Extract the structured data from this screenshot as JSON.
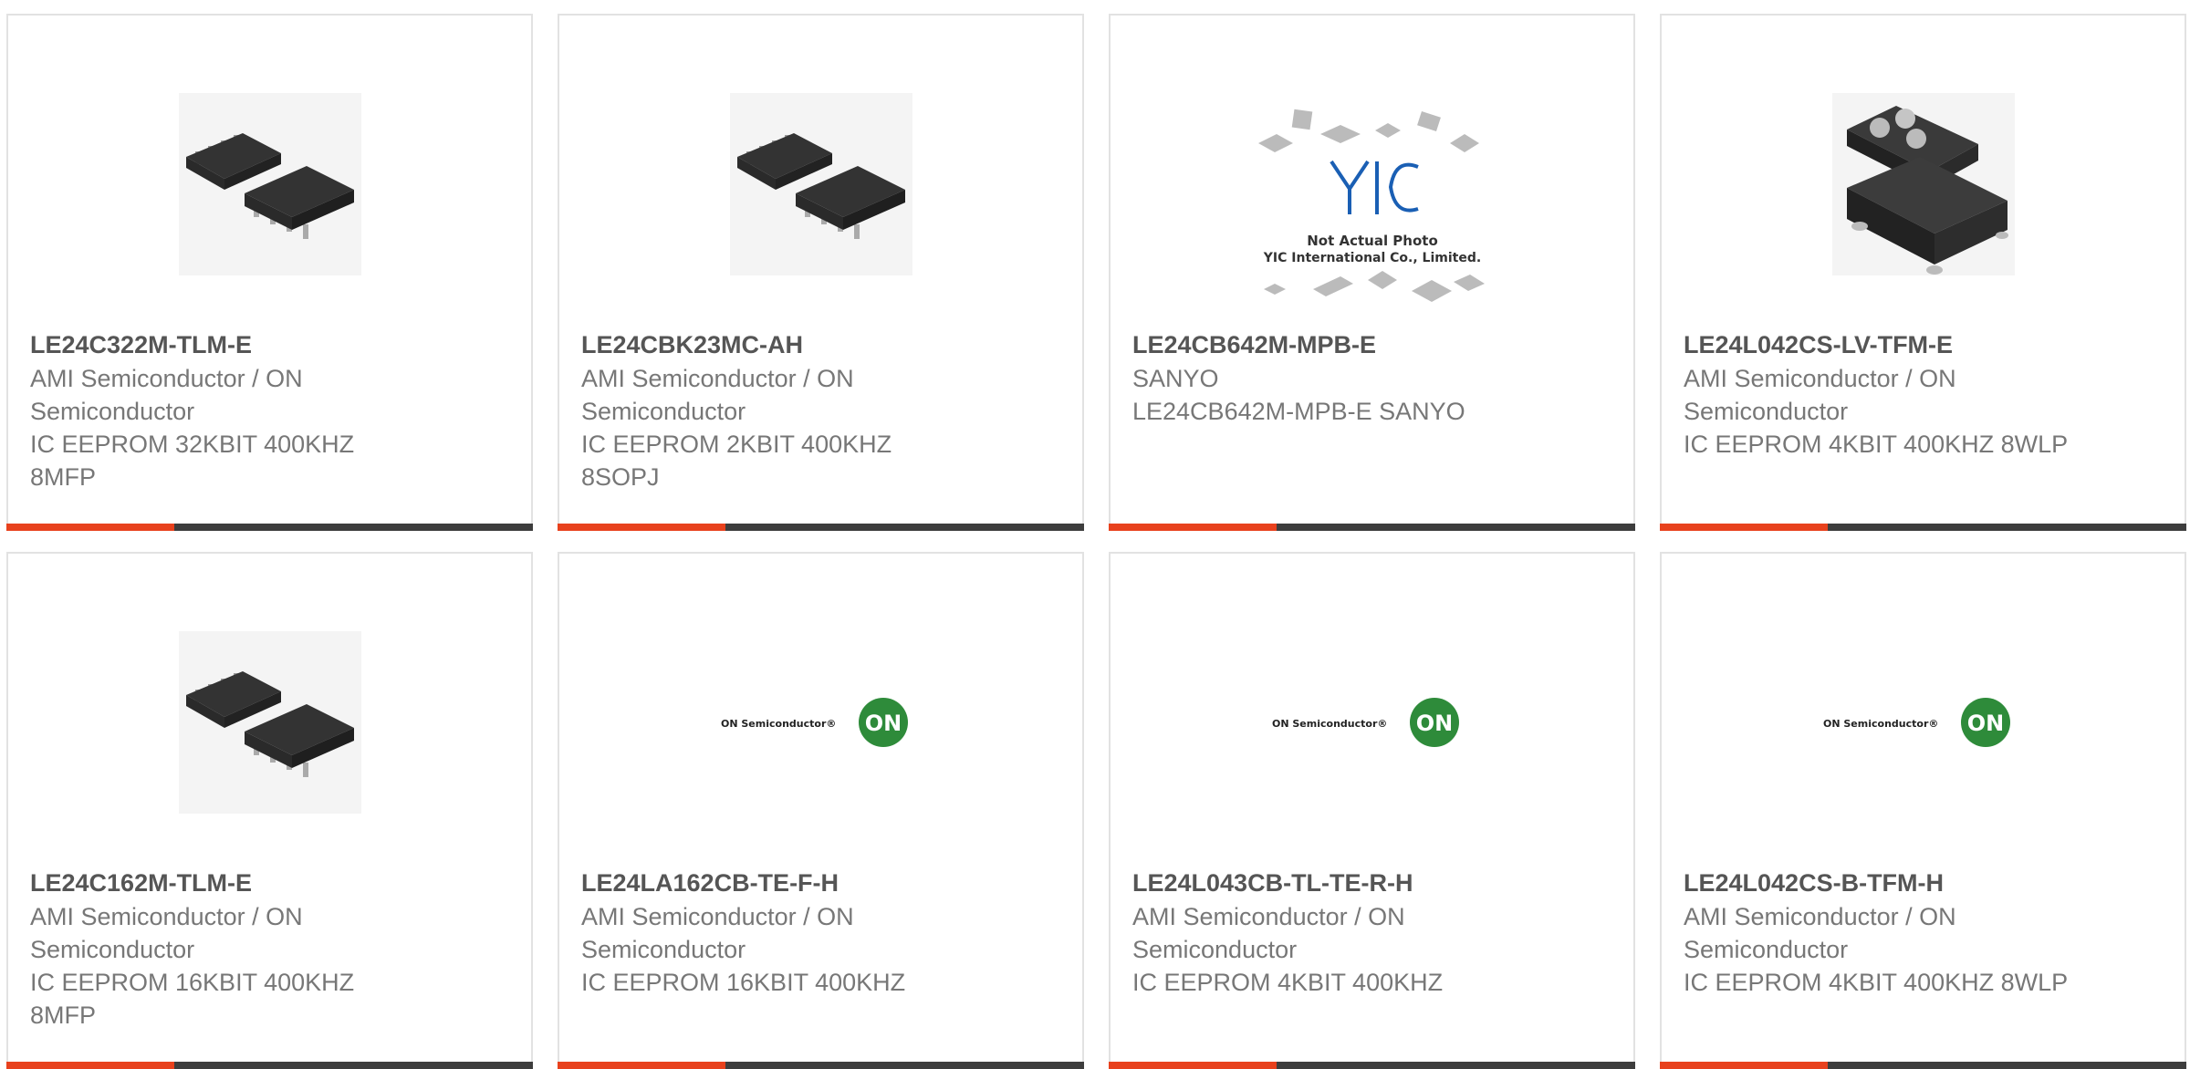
{
  "cards": [
    {
      "part": "LE24C322M-TLM-E",
      "maker": "AMI Semiconductor / ON Semiconductor",
      "desc": "IC EEPROM 32KBIT 400KHZ 8MFP",
      "image": "soic8-chip-icon"
    },
    {
      "part": "LE24CBK23MC-AH",
      "maker": "AMI Semiconductor / ON Semiconductor",
      "desc": "IC EEPROM 2KBIT 400KHZ 8SOPJ",
      "image": "soic8-chip-icon"
    },
    {
      "part": "LE24CB642M-MPB-E",
      "maker": "SANYO",
      "desc": "LE24CB642M-MPB-E SANYO",
      "image": "yic-not-actual-photo-icon",
      "placeholder_lines": [
        "Not Actual Photo",
        "YIC International Co., Limited."
      ],
      "placeholder_logo": "YIC"
    },
    {
      "part": "LE24L042CS-LV-TFM-E",
      "maker": "AMI Semiconductor / ON Semiconductor",
      "desc": "IC EEPROM 4KBIT 400KHZ 8WLP",
      "image": "wlp-chip-icon"
    },
    {
      "part": "LE24C162M-TLM-E",
      "maker": "AMI Semiconductor / ON Semiconductor",
      "desc": "IC EEPROM 16KBIT 400KHZ 8MFP",
      "image": "soic8-chip-icon"
    },
    {
      "part": "LE24LA162CB-TE-F-H",
      "maker": "AMI Semiconductor / ON Semiconductor",
      "desc": "IC EEPROM 16KBIT 400KHZ",
      "image": "on-semiconductor-logo",
      "logo_text": "ON Semiconductor®",
      "logo_badge": "ON"
    },
    {
      "part": "LE24L043CB-TL-TE-R-H",
      "maker": "AMI Semiconductor / ON Semiconductor",
      "desc": "IC EEPROM 4KBIT 400KHZ",
      "image": "on-semiconductor-logo",
      "logo_text": "ON Semiconductor®",
      "logo_badge": "ON"
    },
    {
      "part": "LE24L042CS-B-TFM-H",
      "maker": "AMI Semiconductor / ON Semiconductor",
      "desc": "IC EEPROM 4KBIT 400KHZ 8WLP",
      "image": "on-semiconductor-logo",
      "logo_text": "ON Semiconductor®",
      "logo_badge": "ON"
    }
  ],
  "colors": {
    "accent": "#e8411d",
    "bar": "#3d3d3d",
    "border": "#e2e2e2",
    "on_green": "#2e8b3a"
  }
}
